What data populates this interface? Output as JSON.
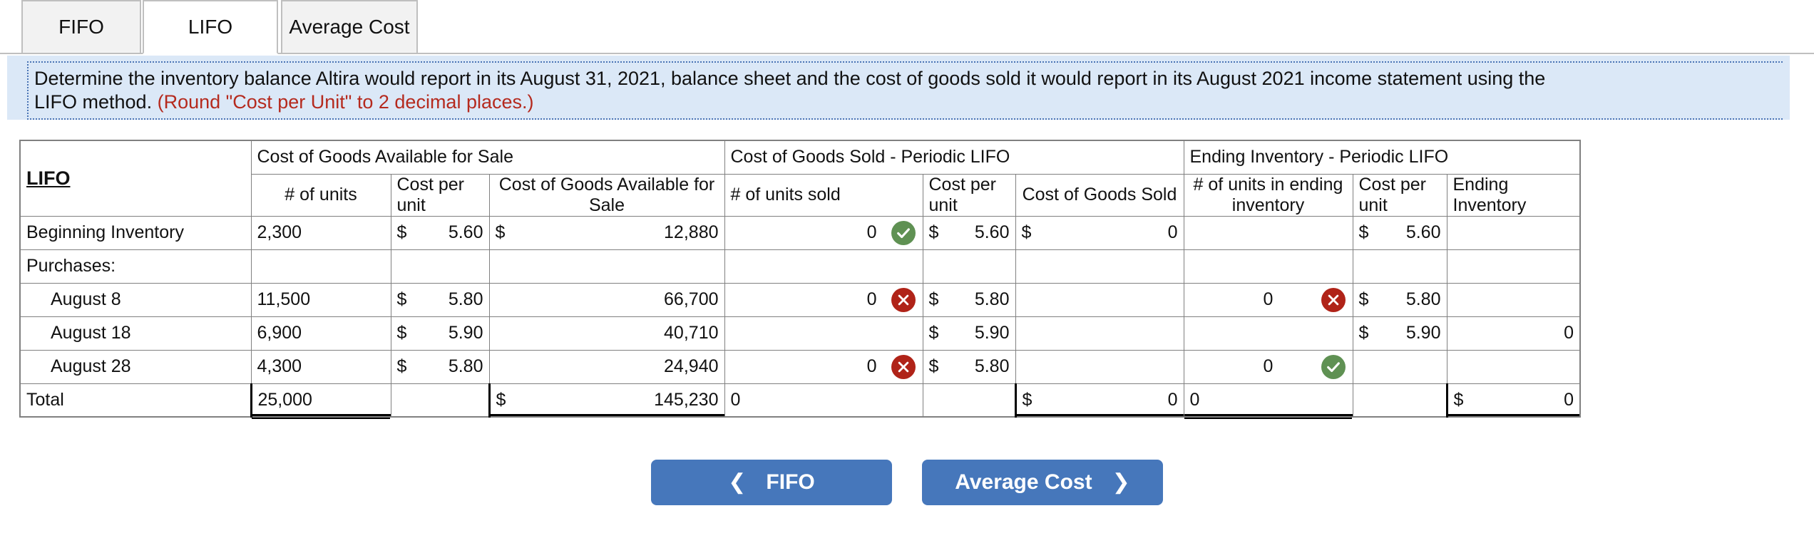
{
  "tabs": [
    {
      "label": "FIFO",
      "active": false
    },
    {
      "label": "LIFO",
      "active": true
    },
    {
      "label": "Average Cost",
      "active": false
    }
  ],
  "instruction": {
    "line1": "Determine the inventory balance Altira would report in its August 31, 2021, balance sheet and the cost of goods sold it would report in its August 2021 income statement using the",
    "line2_black": "LIFO method.",
    "line2_red": "(Round \"Cost per Unit\" to 2 decimal places.)"
  },
  "table": {
    "corner_label": "LIFO",
    "groups": [
      {
        "label": "Cost of Goods Available for Sale"
      },
      {
        "label": "Cost of Goods Sold - Periodic LIFO"
      },
      {
        "label": "Ending Inventory - Periodic LIFO"
      }
    ],
    "subheaders": [
      "# of units",
      "Cost per unit",
      "Cost of Goods Available for Sale",
      "# of units sold",
      "Cost per unit",
      "Cost of Goods Sold",
      "# of units in ending inventory",
      "Cost per unit",
      "Ending Inventory"
    ],
    "rows": [
      {
        "label": "Beginning Inventory",
        "avail_units": "2,300",
        "avail_cost_sym": "$",
        "avail_cost": "5.60",
        "avail_total_sym": "$",
        "avail_total": "12,880",
        "sold_units": "0",
        "sold_status": "ok",
        "sold_cost_sym": "$",
        "sold_cost": "5.60",
        "cogs_sym": "$",
        "cogs": "0",
        "end_units": "",
        "end_status": "",
        "end_cost_sym": "$",
        "end_cost": "5.60",
        "end_total_sym": "",
        "end_total": ""
      },
      {
        "label": "Purchases:",
        "avail_units": "",
        "avail_cost_sym": "",
        "avail_cost": "",
        "avail_total_sym": "",
        "avail_total": "",
        "sold_units": "",
        "sold_status": "",
        "sold_cost_sym": "",
        "sold_cost": "",
        "cogs_sym": "",
        "cogs": "",
        "end_units": "",
        "end_status": "",
        "end_cost_sym": "",
        "end_cost": "",
        "end_total_sym": "",
        "end_total": ""
      },
      {
        "label": "August 8",
        "indent": true,
        "avail_units": "11,500",
        "avail_cost_sym": "$",
        "avail_cost": "5.80",
        "avail_total_sym": "",
        "avail_total": "66,700",
        "sold_units": "0",
        "sold_status": "bad",
        "sold_cost_sym": "$",
        "sold_cost": "5.80",
        "cogs_sym": "",
        "cogs": "",
        "end_units": "0",
        "end_status": "bad",
        "end_cost_sym": "$",
        "end_cost": "5.80",
        "end_total_sym": "",
        "end_total": ""
      },
      {
        "label": "August 18",
        "indent": true,
        "avail_units": "6,900",
        "avail_cost_sym": "$",
        "avail_cost": "5.90",
        "avail_total_sym": "",
        "avail_total": "40,710",
        "sold_units": "",
        "sold_status": "",
        "sold_cost_sym": "$",
        "sold_cost": "5.90",
        "cogs_sym": "",
        "cogs": "",
        "end_units": "",
        "end_status": "",
        "end_cost_sym": "$",
        "end_cost": "5.90",
        "end_total_sym": "",
        "end_total": "0"
      },
      {
        "label": "August 28",
        "indent": true,
        "avail_units": "4,300",
        "avail_cost_sym": "$",
        "avail_cost": "5.80",
        "avail_total_sym": "",
        "avail_total": "24,940",
        "sold_units": "0",
        "sold_status": "bad",
        "sold_cost_sym": "$",
        "sold_cost": "5.80",
        "cogs_sym": "",
        "cogs": "",
        "end_units": "0",
        "end_status": "ok",
        "end_cost_sym": "",
        "end_cost": "",
        "end_total_sym": "",
        "end_total": ""
      },
      {
        "label": "Total",
        "total": true,
        "avail_units": "25,000",
        "avail_cost_sym": "",
        "avail_cost": "",
        "avail_total_sym": "$",
        "avail_total": "145,230",
        "sold_units": "0",
        "sold_status": "",
        "sold_cost_sym": "",
        "sold_cost": "",
        "cogs_sym": "$",
        "cogs": "0",
        "end_units": "0",
        "end_status": "",
        "end_cost_sym": "",
        "end_cost": "",
        "end_total_sym": "$",
        "end_total": "0"
      }
    ]
  },
  "buttons": {
    "prev_label": "FIFO",
    "prev_chevron": "chevron-left",
    "next_label": "Average Cost",
    "next_chevron": "chevron-right"
  },
  "colors": {
    "header_band": "#85b0e4",
    "subheader": "#bfcce0",
    "button": "#4677bb",
    "highlight": "#fbf8a8",
    "correct": "#5f9153",
    "incorrect": "#b02318",
    "instruction_bg": "#dbe8f7",
    "instruction_red": "#b52a1e"
  }
}
